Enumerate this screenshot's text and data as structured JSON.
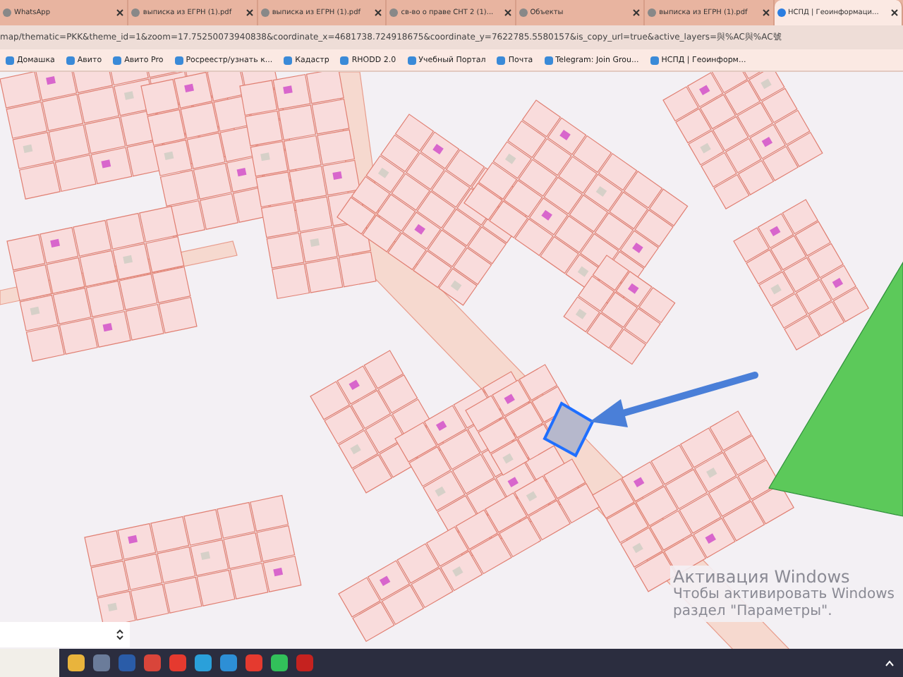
{
  "tabs": [
    {
      "label": "WhatsApp",
      "selected": false
    },
    {
      "label": "выписка из ЕГРН (1).pdf",
      "selected": false
    },
    {
      "label": "выписка из ЕГРН (1).pdf",
      "selected": false
    },
    {
      "label": "св-во о праве СНТ 2 (1)...",
      "selected": false
    },
    {
      "label": "Объекты",
      "selected": false
    },
    {
      "label": "выписка из ЕГРН (1).pdf",
      "selected": false
    },
    {
      "label": "НСПД | Геоинформаци...",
      "selected": true
    }
  ],
  "address": "map/thematic=PKK&theme_id=1&zoom=17.75250073940838&coordinate_x=4681738.724918675&coordinate_y=7622785.5580157&is_copy_url=true&active_layers=與%AC與%AC號",
  "bookmarks": [
    "Домашка",
    "Авито",
    "Авито Pro",
    "Росреестр/узнать к...",
    "Кадастр",
    "RHODD 2.0",
    "Учебный Портал",
    "Почта",
    "Telegram: Join Grou...",
    "НСПД | Геоинформ..."
  ],
  "activation": {
    "title": "Активация Windows",
    "line_1": "Чтобы активировать Windows",
    "line_2": "раздел \"Параметры\"."
  }
}
